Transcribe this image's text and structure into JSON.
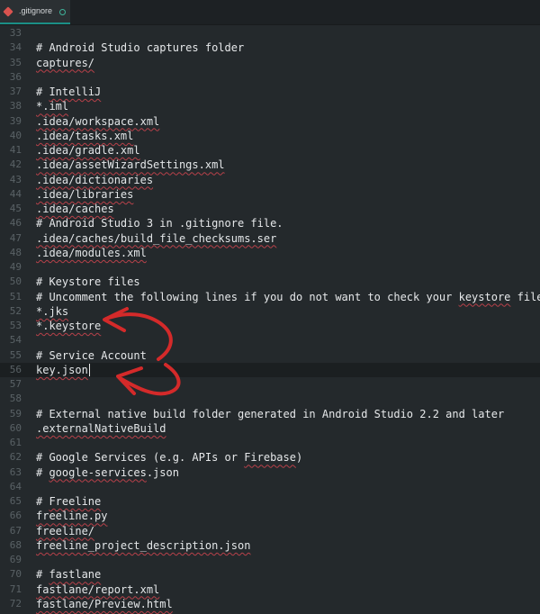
{
  "tab": {
    "title": ".gitignore",
    "icon": "git-diamond-icon"
  },
  "colors": {
    "background": "#24292c",
    "annotation_arrow": "#d42a2a",
    "squiggle": "#b8414a"
  },
  "lines": [
    {
      "n": "33",
      "text": ""
    },
    {
      "n": "34",
      "text": "# Android Studio captures folder"
    },
    {
      "n": "35",
      "text": "captures/"
    },
    {
      "n": "36",
      "text": ""
    },
    {
      "n": "37",
      "text": "# IntelliJ"
    },
    {
      "n": "38",
      "text": "*.iml"
    },
    {
      "n": "39",
      "text": ".idea/workspace.xml"
    },
    {
      "n": "40",
      "text": ".idea/tasks.xml"
    },
    {
      "n": "41",
      "text": ".idea/gradle.xml"
    },
    {
      "n": "42",
      "text": ".idea/assetWizardSettings.xml"
    },
    {
      "n": "43",
      "text": ".idea/dictionaries"
    },
    {
      "n": "44",
      "text": ".idea/libraries"
    },
    {
      "n": "45",
      "text": ".idea/caches"
    },
    {
      "n": "46",
      "text": "# Android Studio 3 in .gitignore file."
    },
    {
      "n": "47",
      "text": ".idea/caches/build_file_checksums.ser"
    },
    {
      "n": "48",
      "text": ".idea/modules.xml"
    },
    {
      "n": "49",
      "text": ""
    },
    {
      "n": "50",
      "text": "# Keystore files"
    },
    {
      "n": "51",
      "text": "# Uncomment the following lines if you do not want to check your keystore files in."
    },
    {
      "n": "52",
      "text": "*.jks"
    },
    {
      "n": "53",
      "text": "*.keystore"
    },
    {
      "n": "54",
      "text": ""
    },
    {
      "n": "55",
      "text": "# Service Account"
    },
    {
      "n": "56",
      "text": "key.json"
    },
    {
      "n": "57",
      "text": ""
    },
    {
      "n": "58",
      "text": ""
    },
    {
      "n": "59",
      "text": "# External native build folder generated in Android Studio 2.2 and later"
    },
    {
      "n": "60",
      "text": ".externalNativeBuild"
    },
    {
      "n": "61",
      "text": ""
    },
    {
      "n": "62",
      "text": "# Google Services (e.g. APIs or Firebase)"
    },
    {
      "n": "63",
      "text": "# google-services.json"
    },
    {
      "n": "64",
      "text": ""
    },
    {
      "n": "65",
      "text": "# Freeline"
    },
    {
      "n": "66",
      "text": "freeline.py"
    },
    {
      "n": "67",
      "text": "freeline/"
    },
    {
      "n": "68",
      "text": "freeline_project_description.json"
    },
    {
      "n": "69",
      "text": ""
    },
    {
      "n": "70",
      "text": "# fastlane"
    },
    {
      "n": "71",
      "text": "fastlane/report.xml"
    },
    {
      "n": "72",
      "text": "fastlane/Preview.html"
    }
  ]
}
